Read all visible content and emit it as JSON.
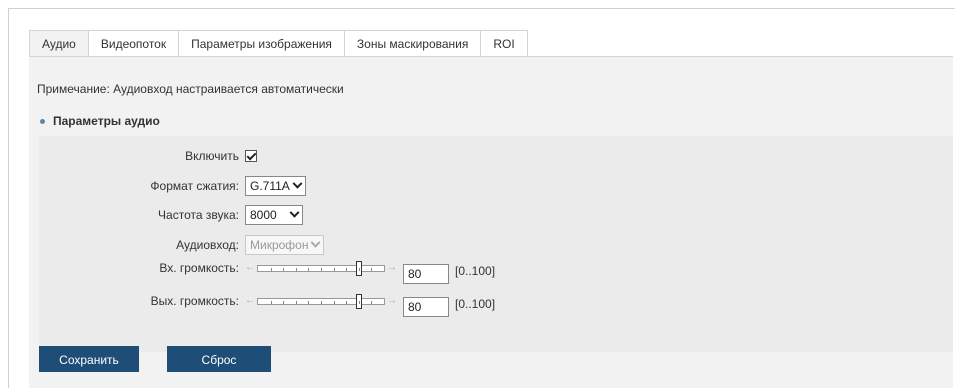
{
  "tabs": [
    {
      "label": "Аудио",
      "active": true
    },
    {
      "label": "Видеопоток",
      "active": false
    },
    {
      "label": "Параметры изображения",
      "active": false
    },
    {
      "label": "Зоны маскирования",
      "active": false
    },
    {
      "label": "ROI",
      "active": false
    }
  ],
  "note": "Примечание: Аудиовход настраивается автоматически",
  "section_title": "Параметры аудио",
  "form": {
    "enable": {
      "label": "Включить",
      "checked": true
    },
    "compression": {
      "label": "Формат сжатия:",
      "value": "G.711A"
    },
    "sample_rate": {
      "label": "Частота звука:",
      "value": "8000"
    },
    "audio_input": {
      "label": "Аудиовход:",
      "value": "Микрофон",
      "disabled": true
    },
    "input_volume": {
      "label": "Вх. громкость:",
      "value": "80",
      "range": "[0..100]"
    },
    "output_volume": {
      "label": "Вых. громкость:",
      "value": "80",
      "range": "[0..100]"
    }
  },
  "buttons": {
    "save": "Сохранить",
    "reset": "Сброс"
  },
  "colors": {
    "button_bg": "#1e4d78",
    "panel_bg": "#f2f2f2",
    "bullet": "#5a88a8"
  }
}
